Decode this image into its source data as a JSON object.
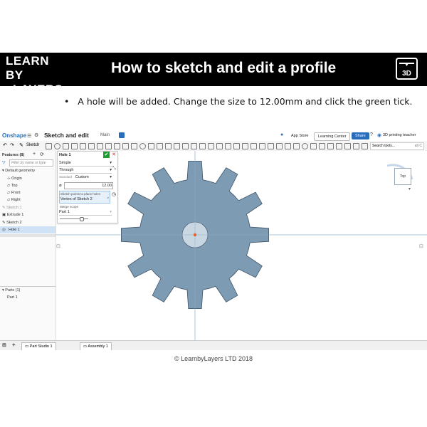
{
  "header": {
    "brand_line1": "LEARN BY",
    "brand_line2": "LAYERS",
    "title": "How to sketch and edit a profile",
    "badge": "3D"
  },
  "instruction": "A hole will be added. Change the size to 12.00mm and click the green tick.",
  "app": {
    "logo": "Onshape",
    "doc_title": "Sketch and edit",
    "branch": "Main",
    "app_store": "App Store",
    "learning_center": "Learning Center",
    "share": "Share",
    "user": "3D printing teacher",
    "search": "Search tools...",
    "search_shortcut": "alt C",
    "sketch_label": "Sketch"
  },
  "features": {
    "header": "Features (8)",
    "filter_placeholder": "Filter by name or type",
    "default_geometry": "Default geometry",
    "items": [
      "Origin",
      "Top",
      "Front",
      "Right",
      "Sketch 1",
      "Extrude 1",
      "Sketch 2",
      "Hole 1"
    ],
    "parts_header": "Parts (1)",
    "part": "Part 1"
  },
  "dialog": {
    "title": "Hole 1",
    "style": "Simple",
    "termination": "Through",
    "standard_label": "Standard",
    "standard_value": "Custom",
    "diameter": "12.00",
    "points_label": "Sketch points to place holes",
    "points_value": "Vertex of Sketch 2",
    "merge_label": "Merge scope",
    "merge_value": "Part 1"
  },
  "tabs": {
    "part_studio": "Part Studio 1",
    "assembly": "Assembly 1"
  },
  "viewcube": "Top",
  "copyright": "© LearnbyLayers LTD 2018",
  "colors": {
    "gear_fill": "#7e9bb4",
    "accent": "#2a6ebb",
    "confirm": "#1f9d2f",
    "cancel": "#d9302c",
    "hole_point": "#e8622a"
  }
}
